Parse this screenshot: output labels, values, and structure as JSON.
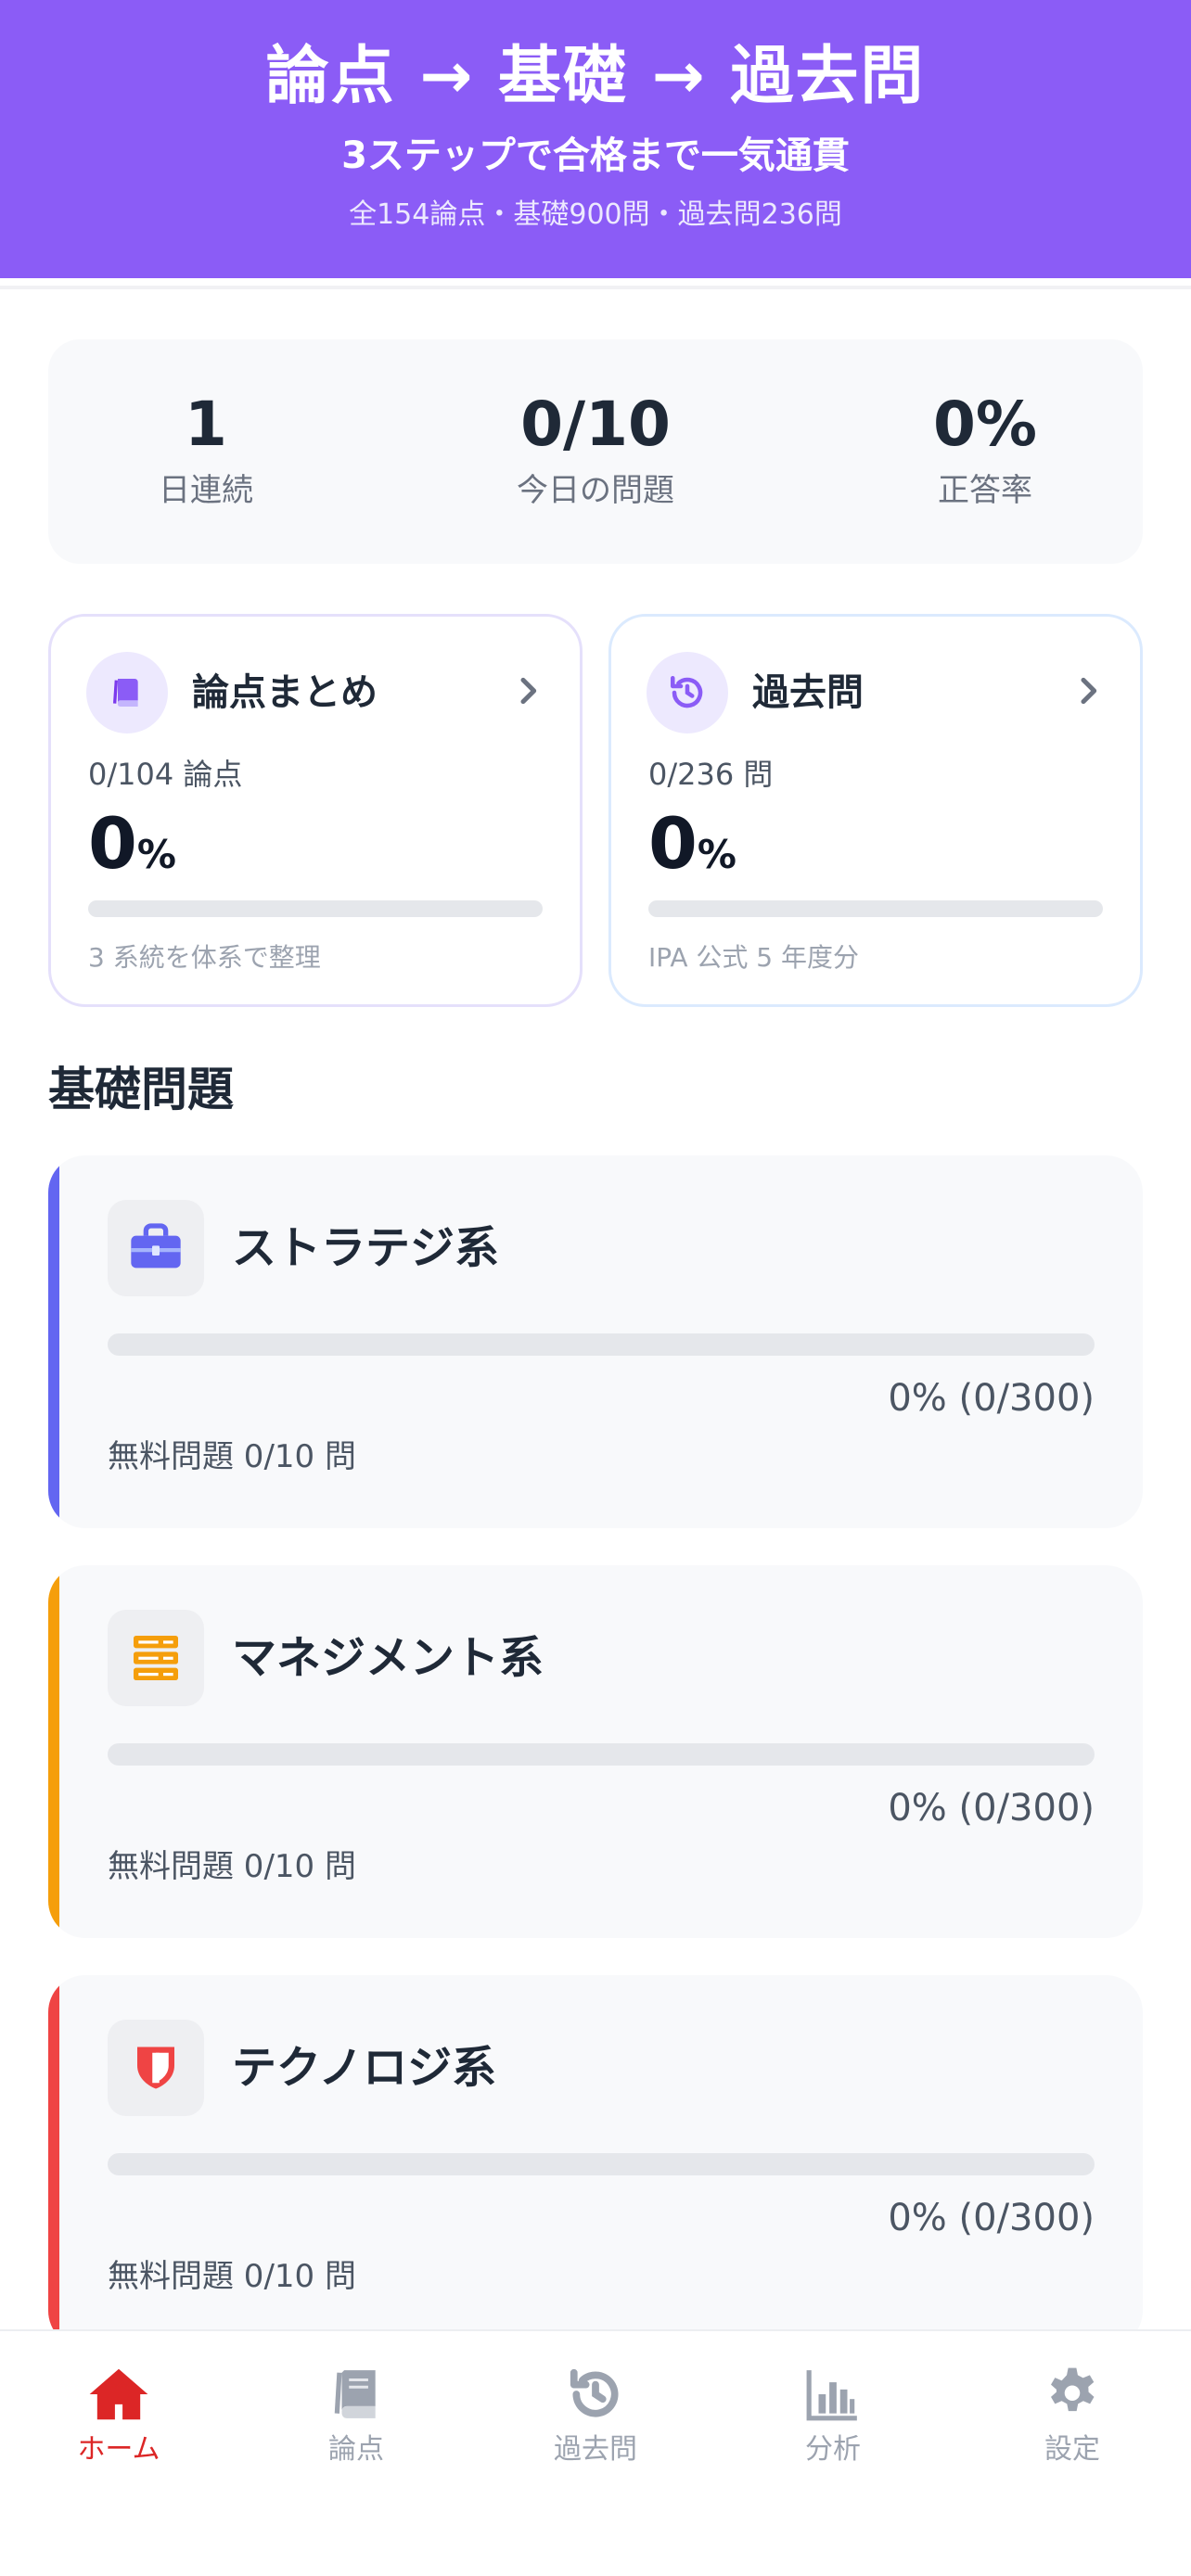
{
  "hero": {
    "title": "論点 → 基礎 → 過去問",
    "subtitle": "3ステップで合格まで一気通貫",
    "meta": "全154論点・基礎900問・過去問236問"
  },
  "stats": [
    {
      "value": "1",
      "label": "日連続"
    },
    {
      "value": "0/10",
      "label": "今日の問題"
    },
    {
      "value": "0%",
      "label": "正答率"
    }
  ],
  "cards": [
    {
      "title": "論点まとめ",
      "count": "0/104 論点",
      "pct": "0",
      "unit": "%",
      "progress": 0,
      "footer": "3 系統を体系で整理",
      "icon": "book-icon"
    },
    {
      "title": "過去問",
      "count": "0/236 問",
      "pct": "0",
      "unit": "%",
      "progress": 0,
      "footer": "IPA 公式 5 年度分",
      "icon": "history-icon"
    }
  ],
  "section": {
    "title": "基礎問題"
  },
  "categories": [
    {
      "title": "ストラテジ系",
      "progress_text": "0% (0/300)",
      "progress": 0,
      "free": "無料問題 0/10 問",
      "icon": "briefcase-icon",
      "color": "#6366f1"
    },
    {
      "title": "マネジメント系",
      "progress_text": "0% (0/300)",
      "progress": 0,
      "free": "無料問題 0/10 問",
      "icon": "server-icon",
      "color": "#f59e0b"
    },
    {
      "title": "テクノロジ系",
      "progress_text": "0% (0/300)",
      "progress": 0,
      "free": "無料問題 0/10 問",
      "icon": "shield-icon",
      "color": "#ef4444"
    }
  ],
  "tabs": [
    {
      "label": "ホーム",
      "icon": "home-icon",
      "active": true
    },
    {
      "label": "論点",
      "icon": "book-icon",
      "active": false
    },
    {
      "label": "過去問",
      "icon": "history-icon",
      "active": false
    },
    {
      "label": "分析",
      "icon": "chart-icon",
      "active": false
    },
    {
      "label": "設定",
      "icon": "gear-icon",
      "active": false
    }
  ],
  "colors": {
    "brand": "#8b5cf6",
    "active_tab": "#dc2626",
    "inactive_tab": "#9ca3af"
  }
}
